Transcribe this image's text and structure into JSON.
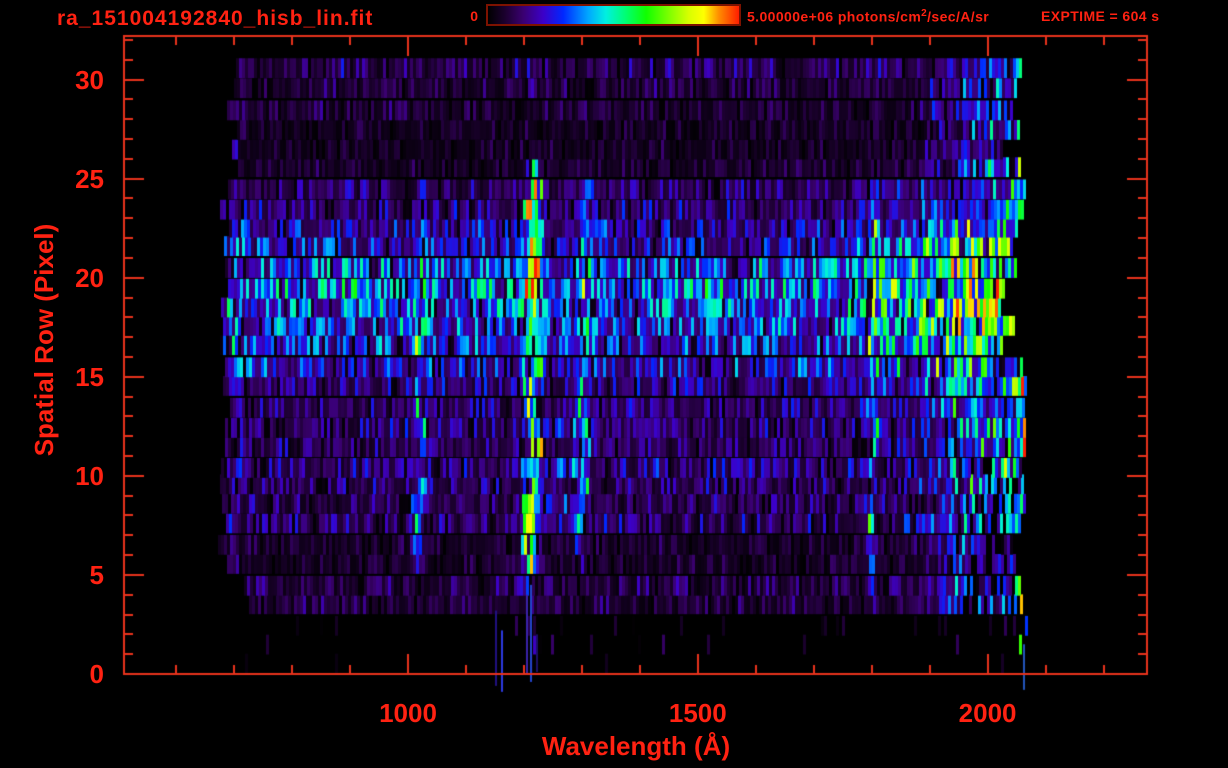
{
  "header": {
    "title": "ra_151004192840_hisb_lin.fit",
    "colorbar_min": "0",
    "colorbar_max": "5.00000e+06",
    "units_prefix": " photons/cm",
    "units_sup": "2",
    "units_suffix": "/sec/A/sr",
    "exptime": "EXPTIME = 604 s"
  },
  "chart_data": {
    "type": "heatmap",
    "title": "ra_151004192840_hisb_lin.fit",
    "xlabel": "Wavelength (Å)",
    "ylabel": "Spatial Row (Pixel)",
    "xlim": [
      510,
      2275
    ],
    "ylim": [
      0,
      32.2
    ],
    "x_major_ticks": [
      1000,
      1500,
      2000
    ],
    "x_minor_step_A": 100,
    "y_major_ticks": [
      0,
      5,
      10,
      15,
      20,
      25,
      30
    ],
    "y_minor_step": 1,
    "colorbar": {
      "min_value": 0,
      "max_value": 5000000,
      "min_label": "0",
      "max_label": "5.00000e+06",
      "units": "photons/cm2/sec/A/sr"
    },
    "exposure_time_s": 604,
    "colors": {
      "text": "#ff2212",
      "frame": "#e8321c",
      "colorbar_border": "#7d1200",
      "background": "#000000"
    },
    "colormap": [
      [
        0.0,
        "#000000"
      ],
      [
        0.07,
        "#1c0030"
      ],
      [
        0.14,
        "#3a0070"
      ],
      [
        0.22,
        "#3c00c8"
      ],
      [
        0.3,
        "#0028ff"
      ],
      [
        0.4,
        "#00a8ff"
      ],
      [
        0.47,
        "#00f0e0"
      ],
      [
        0.55,
        "#00ff70"
      ],
      [
        0.63,
        "#10ff00"
      ],
      [
        0.72,
        "#7cff00"
      ],
      [
        0.8,
        "#d8ff00"
      ],
      [
        0.86,
        "#ffff00"
      ],
      [
        0.92,
        "#ff8c00"
      ],
      [
        1.0,
        "#ff1e00"
      ]
    ],
    "features": {
      "extent": {
        "left_A": 672,
        "right_A": 2066,
        "row_min": 0,
        "row_max": 30
      },
      "background": {
        "level": 0.085
      },
      "band": {
        "center_row": 18.5,
        "sigma": 2.6,
        "amplitude": 0.48,
        "wing_center": 12,
        "wing_sigma": 5,
        "wing_amplitude": 0.1,
        "brighten_from_A": 1720,
        "brighten_to_A": 1870
      },
      "ramp": {
        "from_A": 1850,
        "to_A": 1990,
        "amplitude": 0.22,
        "row_min": 3
      },
      "lines": [
        {
          "A": 705,
          "amp": 0.14,
          "sigma": 4,
          "rows": [
            5,
            28
          ]
        },
        {
          "A": 1019,
          "amp": 0.3,
          "sigma": 5,
          "rows": [
            6,
            23
          ]
        },
        {
          "A": 1213,
          "amp": 0.72,
          "sigma": 8,
          "rows": [
            5,
            24
          ],
          "hot": true
        },
        {
          "A": 1300,
          "amp": 0.26,
          "sigma": 7,
          "rows": [
            6,
            24
          ]
        },
        {
          "A": 1800,
          "amp": 0.28,
          "sigma": 4,
          "rows": [
            3,
            23
          ]
        },
        {
          "A": 2057,
          "amp": 0.5,
          "sigma": 6,
          "rows": [
            1,
            30
          ],
          "hot": true
        }
      ],
      "bridges": {
        "A_range": [
          1222,
          1298
        ],
        "rows": [
          8,
          10,
          12
        ],
        "amp": 0.16
      },
      "spill_streaks": [
        {
          "A": 1152,
          "row_top": 3.2,
          "row_bot": -0.6
        },
        {
          "A": 1163,
          "row_top": 2.2,
          "row_bot": -0.9
        },
        {
          "A": 1206,
          "row_top": 4.0,
          "row_bot": 0.0
        },
        {
          "A": 1213,
          "row_top": 4.5,
          "row_bot": -0.4
        },
        {
          "A": 1222,
          "row_top": 2.0,
          "row_bot": 0.1
        },
        {
          "A": 2062,
          "row_top": 1.5,
          "row_bot": -0.8
        }
      ]
    }
  }
}
